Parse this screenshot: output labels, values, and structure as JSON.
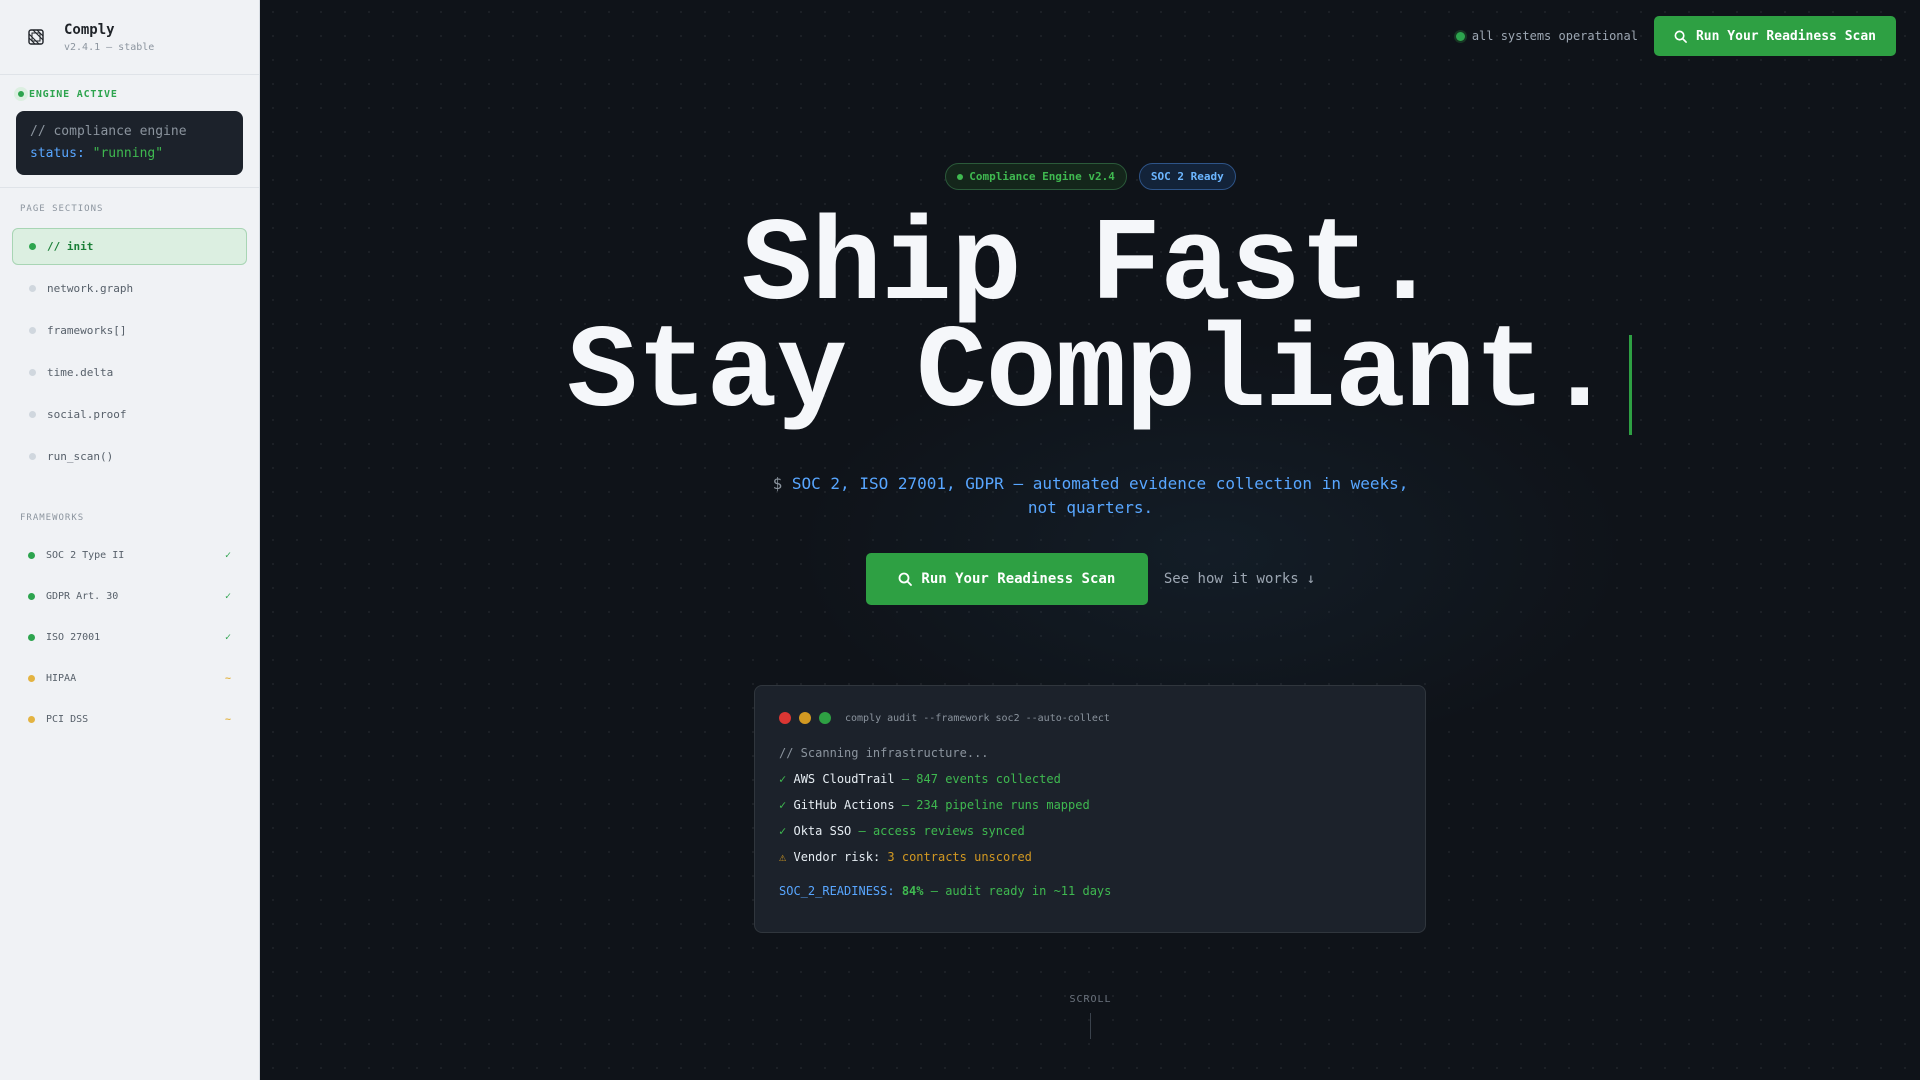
{
  "sidebar": {
    "brand": {
      "name": "Comply",
      "version": "v2.4.1 — stable"
    },
    "engine": {
      "status": "ENGINE ACTIVE",
      "code_comment": "// compliance engine",
      "code_key": "status:",
      "code_value": "\"running\""
    },
    "sections_label": "PAGE SECTIONS",
    "nav": [
      {
        "label": "// init",
        "active": true
      },
      {
        "label": "network.graph"
      },
      {
        "label": "frameworks[]"
      },
      {
        "label": "time.delta"
      },
      {
        "label": "social.proof"
      },
      {
        "label": "run_scan()"
      }
    ],
    "frameworks_label": "FRAMEWORKS",
    "frameworks": [
      {
        "name": "SOC 2 Type II",
        "mark": "✓",
        "status_color": "#2da44e"
      },
      {
        "name": "GDPR Art. 30",
        "mark": "✓",
        "status_color": "#2da44e"
      },
      {
        "name": "ISO 27001",
        "mark": "✓",
        "status_color": "#2da44e"
      },
      {
        "name": "HIPAA",
        "mark": "~",
        "status_color": "#e3b341"
      },
      {
        "name": "PCI DSS",
        "mark": "~",
        "status_color": "#e3b341"
      }
    ]
  },
  "topbar": {
    "status_text": "all systems operational",
    "cta_label": "Run Your Readiness Scan"
  },
  "hero": {
    "badges": {
      "engine": "Compliance Engine v2.4",
      "soc": "SOC 2 Ready"
    },
    "line1": "Ship Fast.",
    "line2": "Stay Compliant.",
    "subtitle_prompt": "$",
    "subtitle_line1": "SOC 2, ISO 27001, GDPR — automated evidence collection in weeks,",
    "subtitle_line2": "not quarters.",
    "cta_label": "Run Your Readiness Scan",
    "secondary_label": "See how it works",
    "secondary_arrow": "↓"
  },
  "terminal": {
    "command": "comply audit --framework soc2 --auto-collect",
    "comment": "// Scanning infrastructure...",
    "lines": [
      {
        "icon": "✓",
        "name": "AWS CloudTrail",
        "detail": "— 847 events collected"
      },
      {
        "icon": "✓",
        "name": "GitHub Actions",
        "detail": "— 234 pipeline runs mapped"
      },
      {
        "icon": "✓",
        "name": "Okta SSO",
        "detail": "— access reviews synced"
      }
    ],
    "warning": {
      "icon": "⚠",
      "name": "Vendor risk:",
      "detail": "3 contracts unscored"
    },
    "readiness": {
      "key": "SOC_2_READINESS:",
      "value": "84%",
      "detail": "— audit ready in ~11 days"
    }
  },
  "scroll_label": "SCROLL",
  "colors": {
    "accent": "#2ea043",
    "link": "#58a6ff",
    "warning": "#d29922",
    "traffic_red": "#da3633",
    "traffic_yellow": "#d29922",
    "traffic_green": "#2ea043"
  }
}
